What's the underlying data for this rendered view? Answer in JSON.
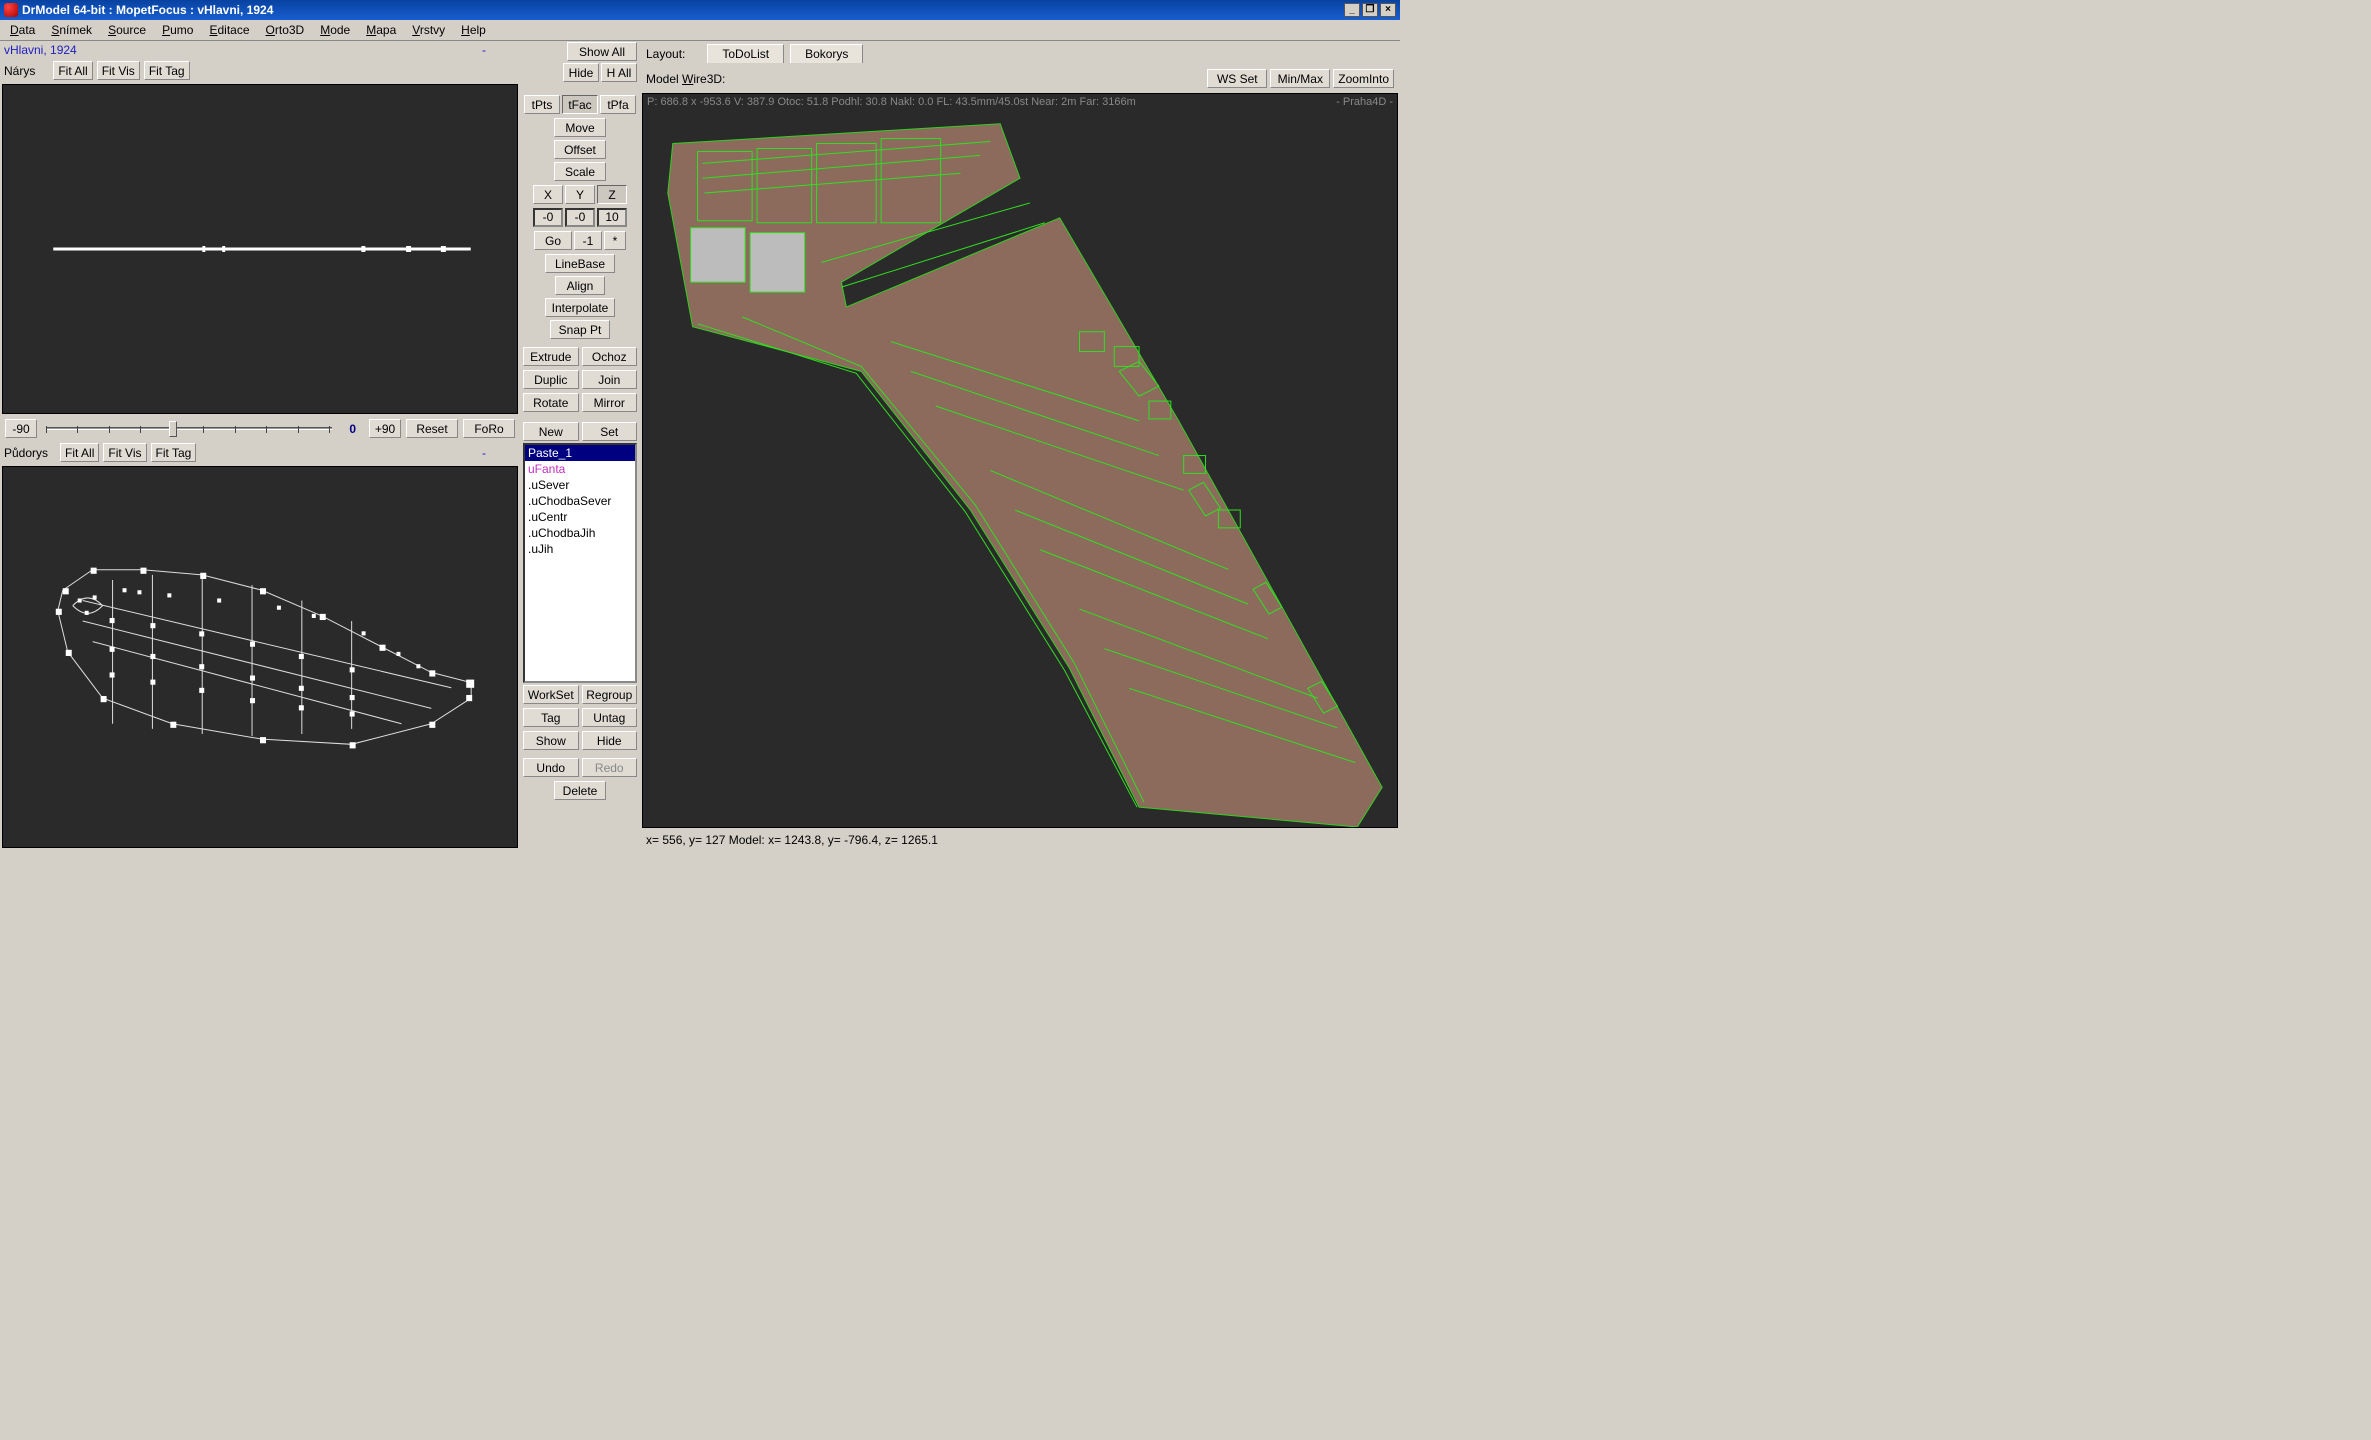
{
  "title": "DrModel 64-bit : MopetFocus : vHlavni, 1924",
  "menu": [
    "Data",
    "Snímek",
    "Source",
    "Pumo",
    "Editace",
    "Orto3D",
    "Mode",
    "Mapa",
    "Vrstvy",
    "Help"
  ],
  "menu_u": [
    "D",
    "S",
    "S",
    "P",
    "E",
    "O",
    "M",
    "M",
    "V",
    "H"
  ],
  "subhead": {
    "name": "vHlavni, 1924",
    "dash": "-"
  },
  "narys": {
    "label": "Nárys",
    "fit_all": "Fit All",
    "fit_vis": "Fit Vis",
    "fit_tag": "Fit Tag",
    "dash": ""
  },
  "narys_row2": {
    "hide": "Hide",
    "h_all": "H All"
  },
  "slider": {
    "minus90": "-90",
    "zero": "0",
    "plus90": "+90",
    "reset": "Reset",
    "foro": "FoRo"
  },
  "pudorys": {
    "label": "Půdorys",
    "fit_all": "Fit All",
    "fit_vis": "Fit Vis",
    "fit_tag": "Fit Tag",
    "dash": "-"
  },
  "mid": {
    "show_all": "Show All",
    "tpts": "tPts",
    "tfac": "tFac",
    "tpfa": "tPfa",
    "move": "Move",
    "offset": "Offset",
    "scale": "Scale",
    "x": "X",
    "y": "Y",
    "z": "Z",
    "nx": "-0",
    "ny": "-0",
    "nz": "10",
    "go": "Go",
    "neg1": "-1",
    "star": "*",
    "linebase": "LineBase",
    "align": "Align",
    "interpolate": "Interpolate",
    "snappt": "Snap Pt",
    "extrude": "Extrude",
    "ochoz": "Ochoz",
    "duplic": "Duplic",
    "join": "Join",
    "rotate": "Rotate",
    "mirror": "Mirror",
    "new": "New",
    "set": "Set",
    "workset": "WorkSet",
    "regroup": "Regroup",
    "tag": "Tag",
    "untag": "Untag",
    "show": "Show",
    "hide": "Hide",
    "undo": "Undo",
    "redo": "Redo",
    "delete": "Delete"
  },
  "list": [
    {
      "t": "Paste_1",
      "c": "sel"
    },
    {
      "t": "uFanta",
      "c": "mag"
    },
    {
      "t": ".uSever",
      "c": ""
    },
    {
      "t": ".uChodbaSever",
      "c": ""
    },
    {
      "t": ".uCentr",
      "c": ""
    },
    {
      "t": ".uChodbaJih",
      "c": ""
    },
    {
      "t": ".uJih",
      "c": ""
    }
  ],
  "layout": {
    "label": "Layout:",
    "todolist": "ToDoList",
    "bokorys": "Bokorys"
  },
  "model": {
    "label": "Model Wire3D:",
    "u": "W",
    "ws_set": "WS Set",
    "min_max": "Min/Max",
    "zoom_into": "ZoomInto"
  },
  "overlay": {
    "top": "P: 686.8 x -953.6  V: 387.9  Otoc: 51.8   Podhl: 30.8   Nakl: 0.0   FL: 43.5mm/45.0st   Near: 2m   Far: 3166m",
    "right": "- Praha4D -"
  },
  "status": "x= 556, y= 127  Model: x= 1243.8, y= -796.4, z= 1265.1"
}
